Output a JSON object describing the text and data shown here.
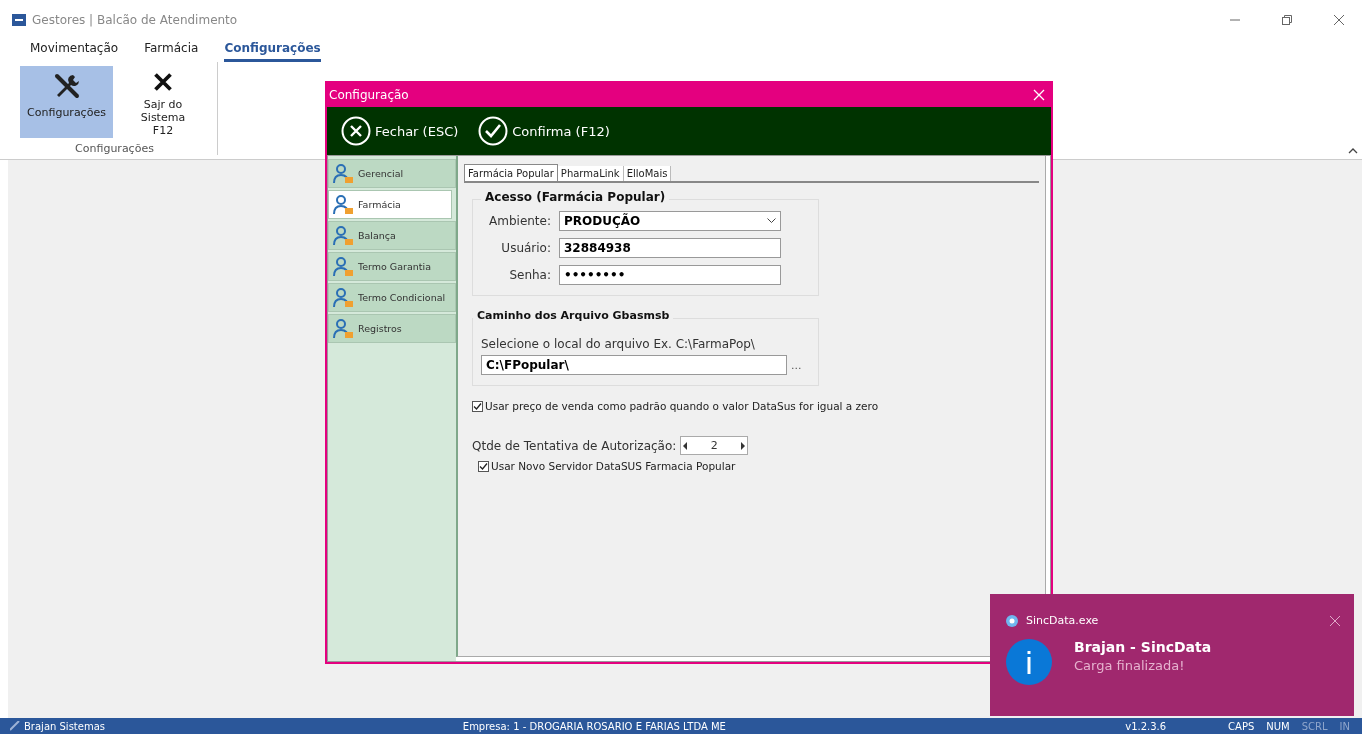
{
  "window": {
    "title": "Gestores | Balcão de Atendimento"
  },
  "menu_tabs": [
    {
      "label": "Movimentação",
      "selected": false
    },
    {
      "label": "Farmácia",
      "selected": false
    },
    {
      "label": "Configurações",
      "selected": true
    }
  ],
  "ribbon": {
    "group_label": "Configurações",
    "buttons": [
      {
        "kind": "tools",
        "label": "Configurações",
        "selected": true
      },
      {
        "kind": "exit",
        "label": "Sajr do Sistema",
        "shortcut": "F12",
        "selected": false
      }
    ]
  },
  "dialog": {
    "title": "Configuração",
    "toolbar": [
      {
        "kind": "close",
        "label": "Fechar (ESC)"
      },
      {
        "kind": "confirm",
        "label": "Confirma (F12)"
      }
    ],
    "sidebar": [
      {
        "label": "Gerencial",
        "selected": false
      },
      {
        "label": "Farmácia",
        "selected": true
      },
      {
        "label": "Balança",
        "selected": false
      },
      {
        "label": "Termo Garantia",
        "selected": false
      },
      {
        "label": "Termo Condicional",
        "selected": false
      },
      {
        "label": "Registros",
        "selected": false
      }
    ],
    "tabs": [
      {
        "label": "Farmácia Popular",
        "selected": true
      },
      {
        "label": "PharmaLink",
        "selected": false
      },
      {
        "label": "ElloMais",
        "selected": false
      }
    ],
    "access": {
      "title": "Acesso (Farmácia Popular)",
      "fields": [
        {
          "kind": "select",
          "label": "Ambiente:",
          "value": "PRODUÇÃO"
        },
        {
          "kind": "text",
          "label": "Usuário:",
          "value": "32884938"
        },
        {
          "kind": "text",
          "label": "Senha:",
          "value": "••••••••"
        }
      ]
    },
    "path": {
      "title": "Caminho dos Arquivo Gbasmsb",
      "hint": "Selecione o local do arquivo Ex. C:\\FarmaPop\\",
      "value": "C:\\FPopular\\",
      "browse": "..."
    },
    "use_sale_price": {
      "label": "Usar preço de venda como padrão quando o valor DataSus for igual a zero",
      "checked": true
    },
    "attempts": {
      "label": "Qtde de Tentativa de Autorização:",
      "value": "2"
    },
    "new_server": {
      "label": "Usar Novo Servidor DataSUS Farmacia Popular",
      "checked": true
    }
  },
  "notification": {
    "app": "SincData.exe",
    "title": "Brajan - SincData",
    "message": "Carga finalizada!"
  },
  "status_bar": {
    "company_name": "Brajan Sistemas",
    "empresa": "Empresa: 1 - DROGARIA ROSARIO E FARIAS LTDA ME",
    "version": "v1.2.3.6",
    "keys": [
      {
        "label": "CAPS",
        "on": true
      },
      {
        "label": "NUM",
        "on": true
      },
      {
        "label": "SCRL",
        "on": false
      },
      {
        "label": "IN",
        "on": false
      }
    ]
  }
}
